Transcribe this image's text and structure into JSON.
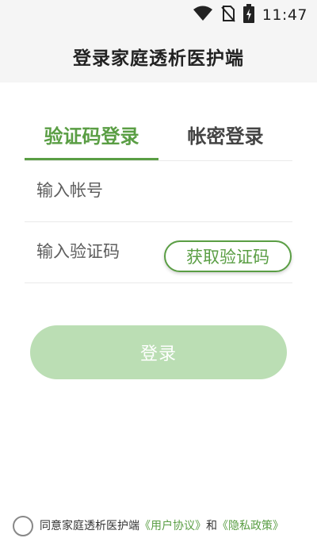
{
  "status_bar": {
    "time": "11:47",
    "icons": [
      "wifi-icon",
      "no-sim-icon",
      "battery-charging-icon"
    ]
  },
  "header": {
    "title": "登录家庭透析医护端"
  },
  "tabs": [
    {
      "label": "验证码登录",
      "active": true
    },
    {
      "label": "帐密登录",
      "active": false
    }
  ],
  "form": {
    "account_placeholder": "输入帐号",
    "account_value": "",
    "code_placeholder": "输入验证码",
    "code_value": "",
    "get_code_label": "获取验证码",
    "login_label": "登录"
  },
  "agreement": {
    "checked": false,
    "prefix": "同意家庭透析医护端",
    "user_agreement": "《用户协议》",
    "and": "和",
    "privacy_policy": "《隐私政策》"
  },
  "colors": {
    "accent": "#5a9e44",
    "button_disabled": "#bbdeb4",
    "header_bg": "#f5f5f5"
  }
}
